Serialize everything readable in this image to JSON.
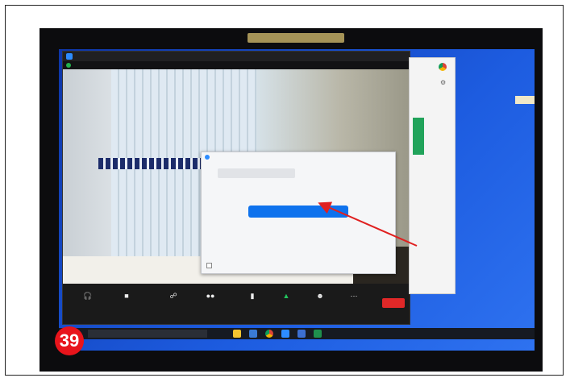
{
  "photo": {
    "badge_number": "39"
  },
  "zoom_window": {
    "title": "",
    "fullscreen_label": "",
    "status_text": "",
    "controls": [
      {
        "label": "",
        "icon": "headphones-icon"
      },
      {
        "label": "",
        "icon": "video-camera-icon"
      },
      {
        "label": "",
        "icon": "security-icon"
      },
      {
        "label": "",
        "icon": "participants-icon"
      },
      {
        "label": "",
        "icon": "chat-icon"
      },
      {
        "label": "",
        "icon": "share-screen-icon"
      },
      {
        "label": "",
        "icon": "reactions-icon"
      },
      {
        "label": "",
        "icon": "more-icon"
      }
    ],
    "end_label": ""
  },
  "dialog": {
    "title": "",
    "tab_phone": "",
    "tab_computer": "",
    "join_button": "",
    "test_link": "",
    "checkbox_label": ""
  },
  "side_window": {
    "label": ""
  },
  "taskbar": {
    "search_placeholder": "",
    "tray_text": ""
  },
  "colors": {
    "zoom_blue": "#0e72ed",
    "end_red": "#e02828",
    "badge_red": "#e8141b",
    "share_green": "#22c55e",
    "arrow_red": "#e02020"
  }
}
